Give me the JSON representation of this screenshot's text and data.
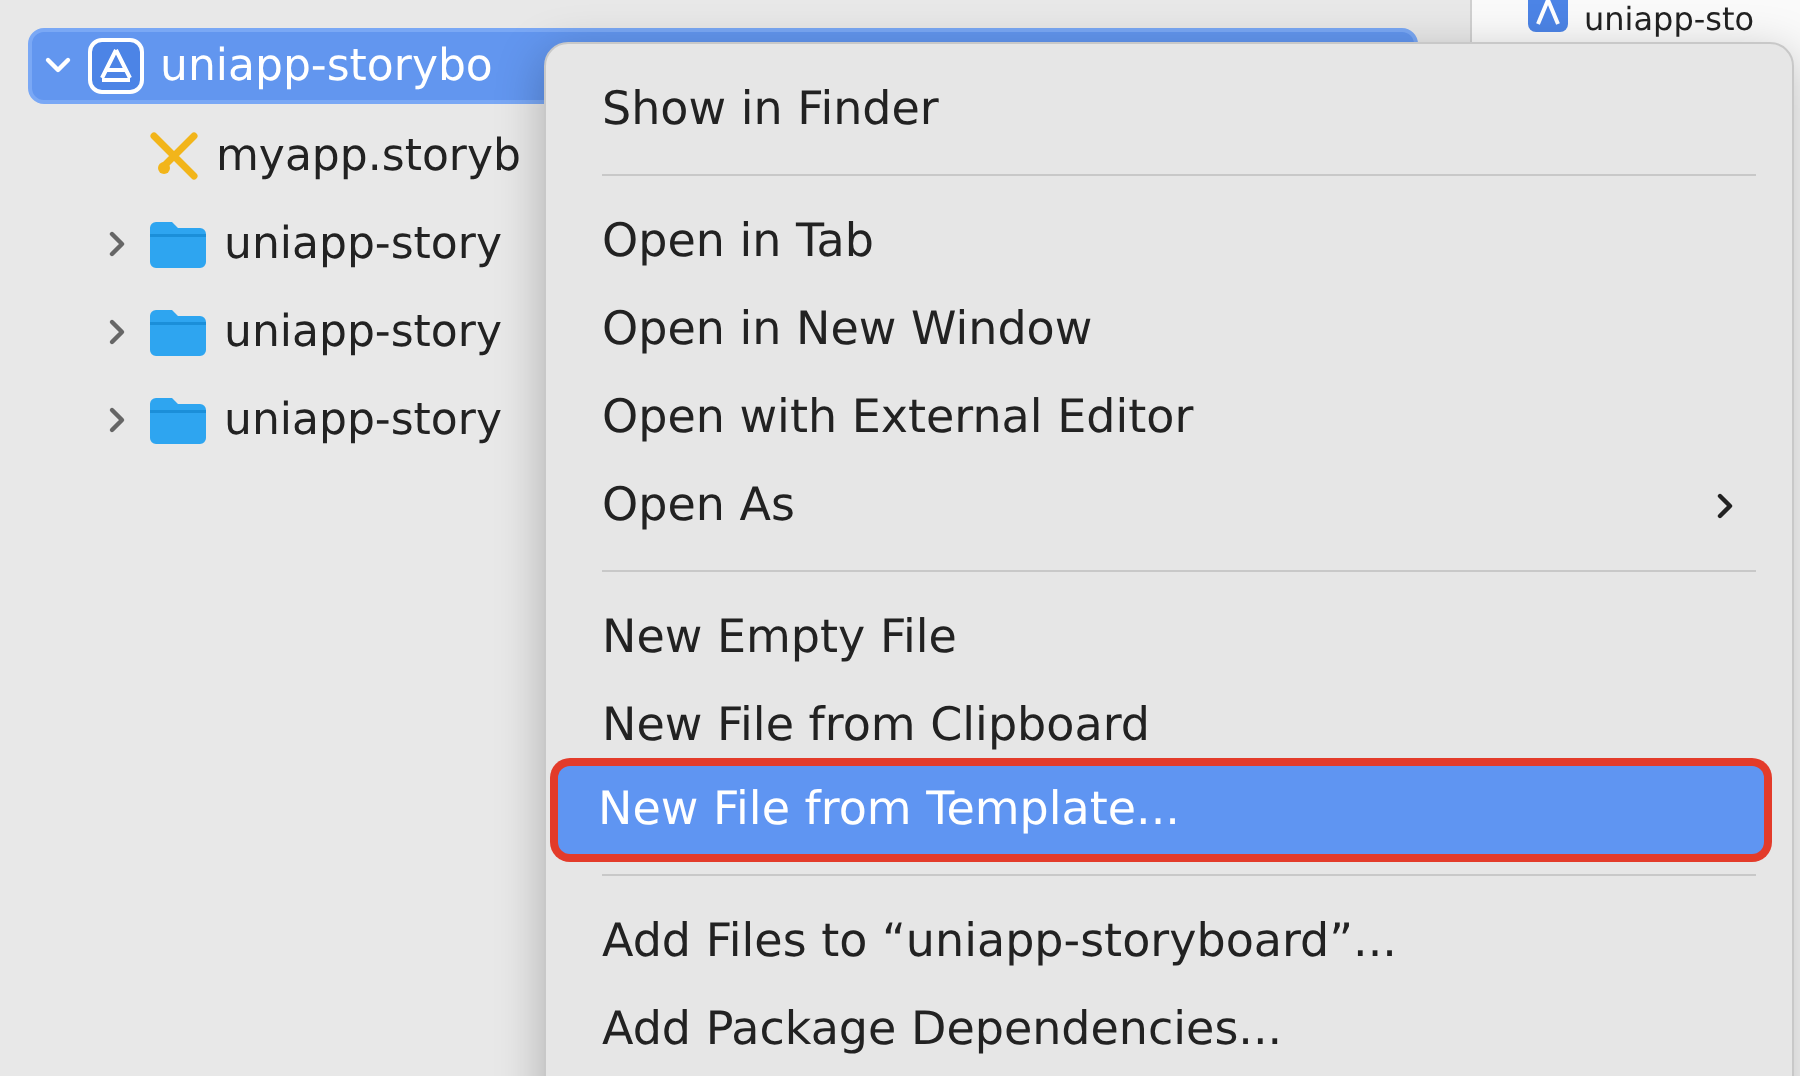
{
  "navigator": {
    "items": [
      {
        "kind": "project",
        "label": "uniapp-storybo",
        "expanded": true,
        "selected": true,
        "children": [
          {
            "kind": "storyboard",
            "label": "myapp.storyb",
            "selected": false
          },
          {
            "kind": "folder",
            "label": "uniapp-story",
            "expanded": false,
            "selected": false
          },
          {
            "kind": "folder",
            "label": "uniapp-story",
            "expanded": false,
            "selected": false
          },
          {
            "kind": "folder",
            "label": "uniapp-story",
            "expanded": false,
            "selected": false
          }
        ]
      }
    ]
  },
  "editor": {
    "tab": {
      "label": "uniapp-sto"
    }
  },
  "context_menu": {
    "items": [
      {
        "kind": "item",
        "label": "Show in Finder",
        "selected": false
      },
      {
        "kind": "separator"
      },
      {
        "kind": "item",
        "label": "Open in Tab",
        "selected": false
      },
      {
        "kind": "item",
        "label": "Open in New Window",
        "selected": false
      },
      {
        "kind": "item",
        "label": "Open with External Editor",
        "selected": false
      },
      {
        "kind": "submenu",
        "label": "Open As",
        "selected": false
      },
      {
        "kind": "separator"
      },
      {
        "kind": "item",
        "label": "New Empty File",
        "selected": false
      },
      {
        "kind": "item",
        "label": "New File from Clipboard",
        "selected": false
      },
      {
        "kind": "item",
        "label": "New File from Template...",
        "selected": true,
        "outlined": true
      },
      {
        "kind": "separator"
      },
      {
        "kind": "item",
        "label": "Add Files to “uniapp-storyboard”...",
        "selected": false
      },
      {
        "kind": "item",
        "label": "Add Package Dependencies...",
        "selected": false
      }
    ]
  }
}
